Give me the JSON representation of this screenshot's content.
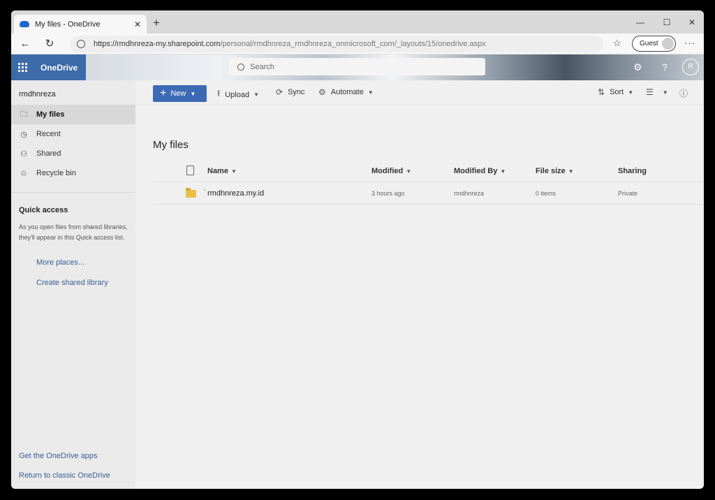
{
  "browser": {
    "tab_title": "My files - OneDrive",
    "tab_close": "✕",
    "new_tab": "+",
    "window_controls": {
      "minimize": "—",
      "maximize": "☐",
      "close": "✕"
    },
    "url_host": "https://rmdhnreza-my.sharepoint.com",
    "url_path": "/personal/rmdhnreza_rmdhnreza_onmicrosoft_com/_layouts/15/onedrive.aspx",
    "profile_label": "Guest"
  },
  "suite": {
    "app_name": "OneDrive",
    "search_placeholder": "Search",
    "avatar_initial": "R"
  },
  "sidebar": {
    "user": "rmdhnreza",
    "items": [
      {
        "label": "My files",
        "icon": "folder-icon",
        "active": true
      },
      {
        "label": "Recent",
        "icon": "clock-icon"
      },
      {
        "label": "Shared",
        "icon": "people-icon"
      },
      {
        "label": "Recycle bin",
        "icon": "trash-icon"
      }
    ],
    "quick_access": {
      "title": "Quick access",
      "description": "As you open files from shared libraries, they'll appear in this Quick access list.",
      "more_places": "More places...",
      "create_library": "Create shared library"
    },
    "footer": {
      "get_apps": "Get the OneDrive apps",
      "classic": "Return to classic OneDrive"
    }
  },
  "commands": {
    "new": "New",
    "upload": "Upload",
    "sync": "Sync",
    "automate": "Automate",
    "sort": "Sort"
  },
  "main": {
    "title": "My files",
    "columns": {
      "name": "Name",
      "modified": "Modified",
      "modified_by": "Modified By",
      "file_size": "File size",
      "sharing": "Sharing"
    },
    "rows": [
      {
        "name": "rmdhnreza.my.id",
        "modified": "3 hours ago",
        "modified_by": "rmdhnreza",
        "file_size": "0 items",
        "sharing": "Private"
      }
    ]
  },
  "colors": {
    "brand_blue": "#3d6aa8",
    "new_button": "#3d6ab5",
    "folder_yellow": "#e9bf48"
  }
}
